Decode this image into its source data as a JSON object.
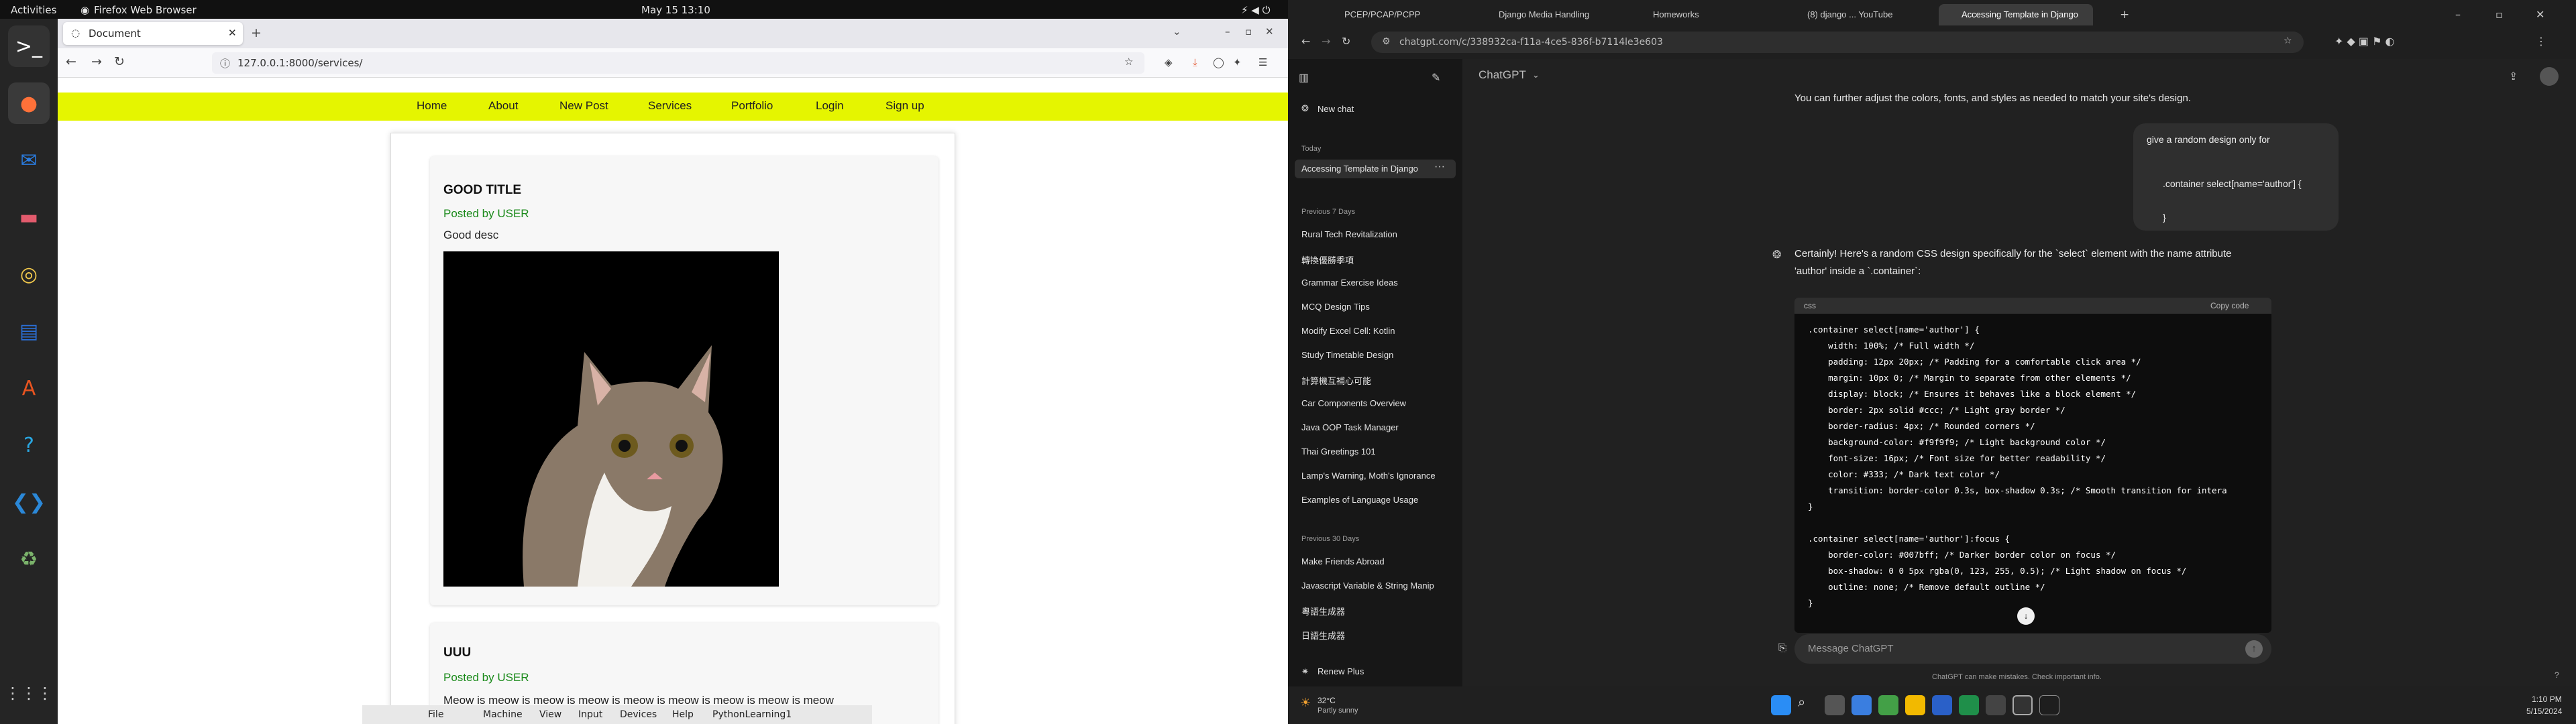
{
  "ubuntu": {
    "activities": "Activities",
    "app_name": "Firefox Web Browser",
    "clock": "May 15  13:10"
  },
  "firefox": {
    "tab_title": "Document",
    "url": "127.0.0.1:8000/services/",
    "site_nav": [
      "Home",
      "About",
      "New Post",
      "Services",
      "Portfolio",
      "Login",
      "Sign up"
    ],
    "posts": [
      {
        "title": "GOOD TITLE",
        "byline": "Posted by USER",
        "desc": "Good desc"
      },
      {
        "title": "UUU",
        "byline": "Posted by USER",
        "desc": "Meow is meow is meow is meow is meow is meow is meow is meow is meow"
      }
    ]
  },
  "vbox_menu": [
    "File",
    "Machine",
    "View",
    "Input",
    "Devices",
    "Help",
    "PythonLearning1"
  ],
  "chrome": {
    "tabs": [
      "PCEP/PCAP/PCPP",
      "Django Media Handling",
      "Homeworks",
      "(8) django ... YouTube",
      "Accessing Template in Django"
    ],
    "url": "chatgpt.com/c/338932ca-f11a-4ce5-836f-b7114le3e603"
  },
  "gpt": {
    "title": "ChatGPT",
    "new_chat": "New chat",
    "today_label": "Today",
    "today": [
      "Accessing Template in Django"
    ],
    "prev7_label": "Previous 7 Days",
    "prev7": [
      "Rural Tech Revitalization",
      "轉換優勝季項",
      "Grammar Exercise Ideas",
      "MCQ Design Tips",
      "Modify Excel Cell: Kotlin",
      "Study Timetable Design",
      "計算機互補心可能",
      "Car Components Overview",
      "Java OOP Task Manager",
      "Thai Greetings 101",
      "Lamp's Warning, Moth's Ignorance",
      "Examples of Language Usage"
    ],
    "prev30_label": "Previous 30 Days",
    "prev30": [
      "Make Friends Abroad",
      "Javascript Variable & String Manip",
      "粵語生成器",
      "日語生成器"
    ],
    "renew": "Renew Plus",
    "msg_prev": "You can further adjust the colors, fonts, and styles as needed to match your site's design.",
    "user_msg1": "give a random design only for",
    "user_msg2": ".container select[name='author'] {",
    "user_msg3": "}",
    "reply1": "Certainly! Here's a random CSS design specifically for the `select` element with the name attribute",
    "reply2": "'author' inside a `.container`:",
    "code_lang": "css",
    "copy": "Copy code",
    "code": [
      ".container select[name='author'] {",
      "    width: 100%; /* Full width */",
      "    padding: 12px 20px; /* Padding for a comfortable click area */",
      "    margin: 10px 0; /* Margin to separate from other elements */",
      "    display: block; /* Ensures it behaves like a block element */",
      "    border: 2px solid #ccc; /* Light gray border */",
      "    border-radius: 4px; /* Rounded corners */",
      "    background-color: #f9f9f9; /* Light background color */",
      "    font-size: 16px; /* Font size for better readability */",
      "    color: #333; /* Dark text color */",
      "    transition: border-color 0.3s, box-shadow 0.3s; /* Smooth transition for intera",
      "}",
      "",
      ".container select[name='author']:focus {",
      "    border-color: #007bff; /* Darker border color on focus */",
      "    box-shadow: 0 0 5px rgba(0, 123, 255, 0.5); /* Light shadow on focus */",
      "    outline: none; /* Remove default outline */",
      "}"
    ],
    "input_placeholder": "Message ChatGPT",
    "disclaimer": "ChatGPT can make mistakes. Check important info."
  },
  "taskbar": {
    "temp": "32°C",
    "weather": "Partly sunny",
    "time": "1:10 PM",
    "date": "5/15/2024"
  }
}
